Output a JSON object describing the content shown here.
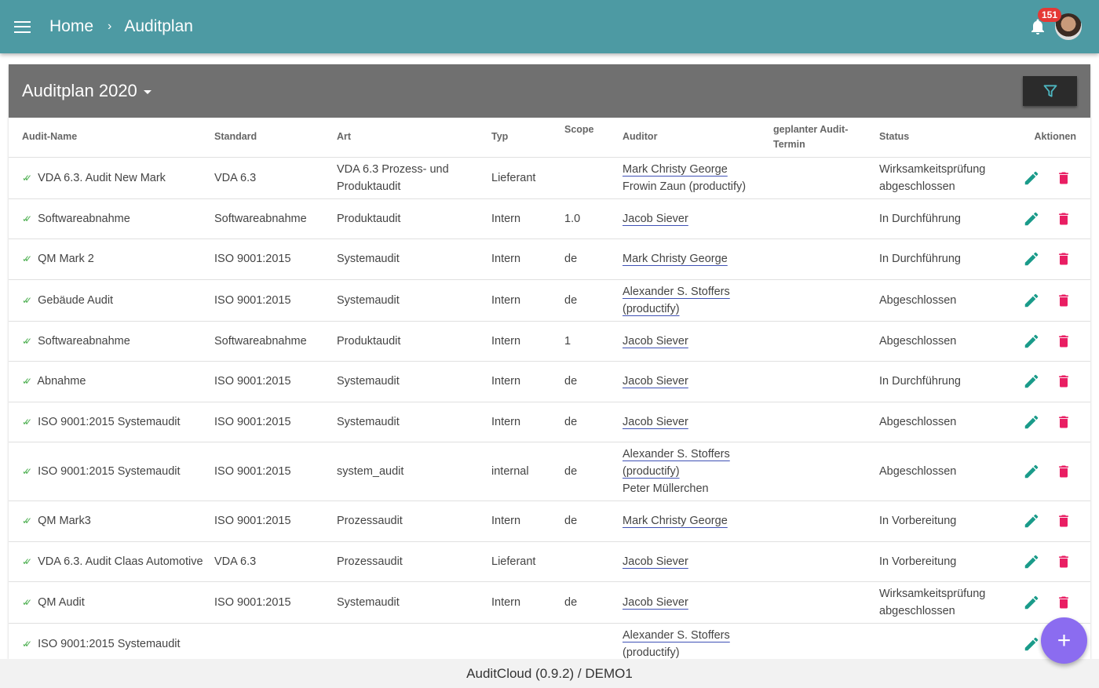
{
  "header": {
    "home": "Home",
    "separator": "›",
    "current": "Auditplan",
    "notification_count": "151"
  },
  "panel": {
    "title": "Auditplan 2020"
  },
  "columns": [
    "Audit-Name",
    "Standard",
    "Art",
    "Typ",
    "Scope",
    "Auditor",
    "geplanter Audit-Termin",
    "Status",
    "Aktionen"
  ],
  "rows": [
    {
      "name": "VDA 6.3. Audit New Mark",
      "standard": "VDA 6.3",
      "art": "VDA 6.3 Prozess- und Produktaudit",
      "typ": "Lieferant",
      "scope": "",
      "auditors": [
        {
          "n": "Mark Christy George",
          "link": true
        },
        {
          "n": "Frowin Zaun (productify)",
          "link": false
        }
      ],
      "termin": "",
      "status": "Wirksamkeitsprüfung abgeschlossen"
    },
    {
      "name": "Softwareabnahme",
      "standard": "Softwareabnahme",
      "art": "Produktaudit",
      "typ": "Intern",
      "scope": "1.0",
      "auditors": [
        {
          "n": "Jacob Siever",
          "link": true
        }
      ],
      "termin": "",
      "status": "In Durchführung"
    },
    {
      "name": "QM Mark 2",
      "standard": "ISO 9001:2015",
      "art": "Systemaudit",
      "typ": "Intern",
      "scope": "de",
      "auditors": [
        {
          "n": "Mark Christy George",
          "link": true
        }
      ],
      "termin": "",
      "status": "In Durchführung"
    },
    {
      "name": "Gebäude Audit",
      "standard": "ISO 9001:2015",
      "art": "Systemaudit",
      "typ": "Intern",
      "scope": "de",
      "auditors": [
        {
          "n": "Alexander S. Stoffers (productify)",
          "link": true
        }
      ],
      "termin": "",
      "status": "Abgeschlossen"
    },
    {
      "name": "Softwareabnahme",
      "standard": "Softwareabnahme",
      "art": "Produktaudit",
      "typ": "Intern",
      "scope": "1",
      "auditors": [
        {
          "n": "Jacob Siever",
          "link": true
        }
      ],
      "termin": "",
      "status": "Abgeschlossen"
    },
    {
      "name": "Abnahme",
      "standard": "ISO 9001:2015",
      "art": "Systemaudit",
      "typ": "Intern",
      "scope": "de",
      "auditors": [
        {
          "n": "Jacob Siever",
          "link": true
        }
      ],
      "termin": "",
      "status": "In Durchführung"
    },
    {
      "name": "ISO 9001:2015 Systemaudit",
      "standard": "ISO 9001:2015",
      "art": "Systemaudit",
      "typ": "Intern",
      "scope": "de",
      "auditors": [
        {
          "n": "Jacob Siever",
          "link": true
        }
      ],
      "termin": "",
      "status": "Abgeschlossen"
    },
    {
      "name": "ISO 9001:2015 Systemaudit",
      "standard": "ISO 9001:2015",
      "art": "system_audit",
      "typ": "internal",
      "scope": "de",
      "auditors": [
        {
          "n": "Alexander S. Stoffers (productify)",
          "link": true
        },
        {
          "n": "Peter Müllerchen",
          "link": false
        }
      ],
      "termin": "",
      "status": "Abgeschlossen"
    },
    {
      "name": "QM Mark3",
      "standard": "ISO 9001:2015",
      "art": "Prozessaudit",
      "typ": "Intern",
      "scope": "de",
      "auditors": [
        {
          "n": "Mark Christy George",
          "link": true
        }
      ],
      "termin": "",
      "status": "In Vorbereitung"
    },
    {
      "name": "VDA 6.3. Audit Claas Automotive",
      "standard": "VDA 6.3",
      "art": "Prozessaudit",
      "typ": "Lieferant",
      "scope": "",
      "auditors": [
        {
          "n": "Jacob Siever",
          "link": true
        }
      ],
      "termin": "",
      "status": "In Vorbereitung"
    },
    {
      "name": "QM Audit",
      "standard": "ISO 9001:2015",
      "art": "Systemaudit",
      "typ": "Intern",
      "scope": "de",
      "auditors": [
        {
          "n": "Jacob Siever",
          "link": true
        }
      ],
      "termin": "",
      "status": "Wirksamkeitsprüfung abgeschlossen"
    },
    {
      "name": "ISO 9001:2015 Systemaudit",
      "standard": "",
      "art": "",
      "typ": "",
      "scope": "",
      "auditors": [
        {
          "n": "Alexander S. Stoffers (productify)",
          "link": true
        }
      ],
      "termin": "",
      "status": ""
    }
  ],
  "footer": "AuditCloud (0.9.2) / DEMO1",
  "fab": "+",
  "colors": {
    "topbar": "#4d9aa3",
    "edit": "#1a9b8a",
    "delete": "#e91e63",
    "fab": "#8b6cf0"
  }
}
